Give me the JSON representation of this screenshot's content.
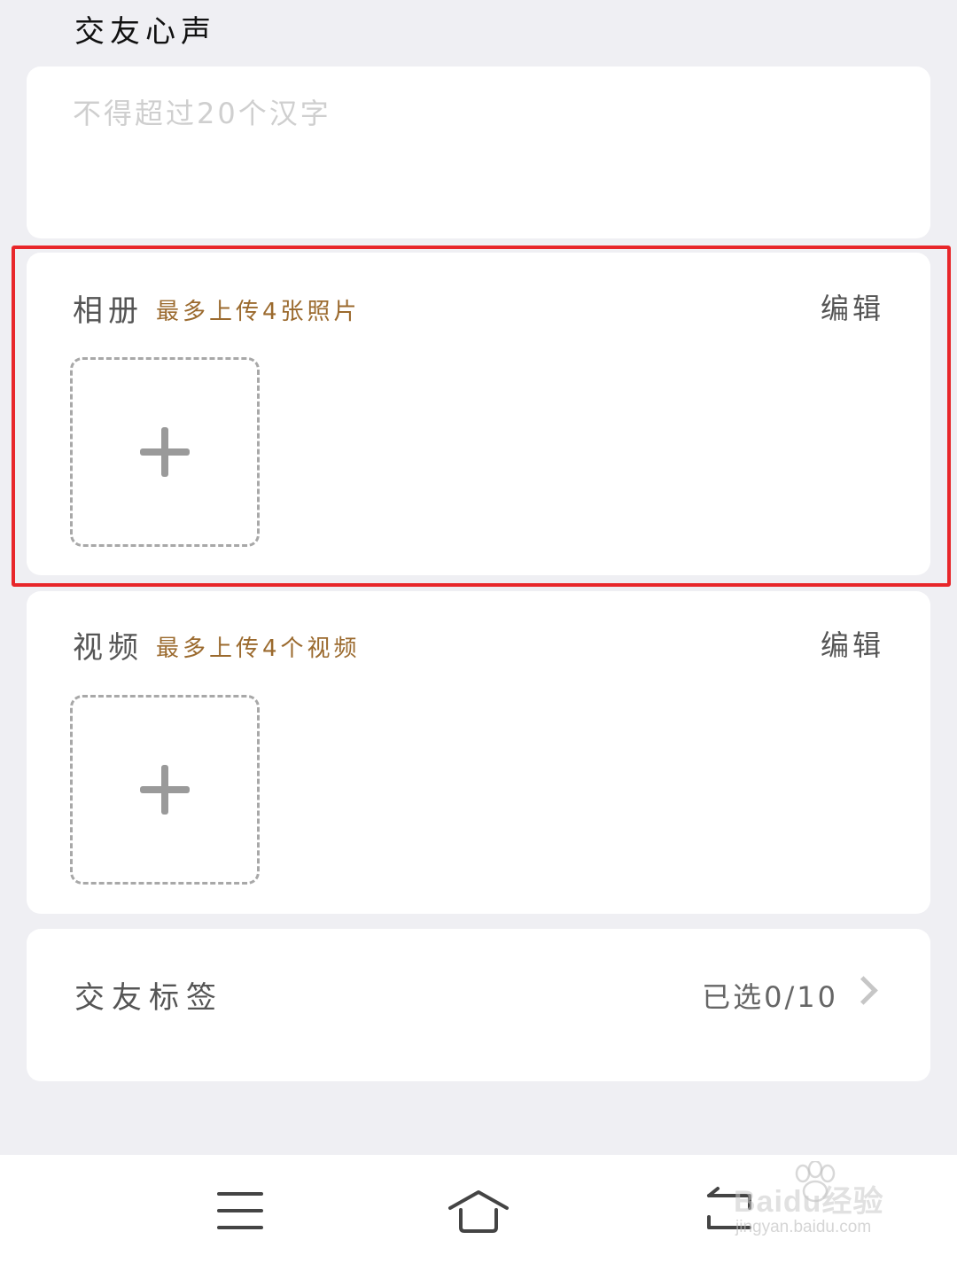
{
  "intro": {
    "title": "交友心声",
    "placeholder": "不得超过20个汉字"
  },
  "album": {
    "title": "相册",
    "hint": "最多上传4张照片",
    "edit_label": "编辑",
    "add_icon": "plus-icon"
  },
  "video": {
    "title": "视频",
    "hint": "最多上传4个视频",
    "edit_label": "编辑",
    "add_icon": "plus-icon"
  },
  "tags": {
    "label": "交友标签",
    "status": "已选0/10",
    "icon": "chevron-right-icon"
  },
  "navbar": {
    "items": [
      {
        "icon": "menu-icon"
      },
      {
        "icon": "home-icon"
      },
      {
        "icon": "back-icon"
      }
    ]
  },
  "watermark": {
    "brand": "Baidu经验",
    "url": "jingyan.baidu.com"
  },
  "colors": {
    "background": "#efeff3",
    "card": "#ffffff",
    "hint": "#9b6a2e",
    "highlight": "#e8262a"
  }
}
